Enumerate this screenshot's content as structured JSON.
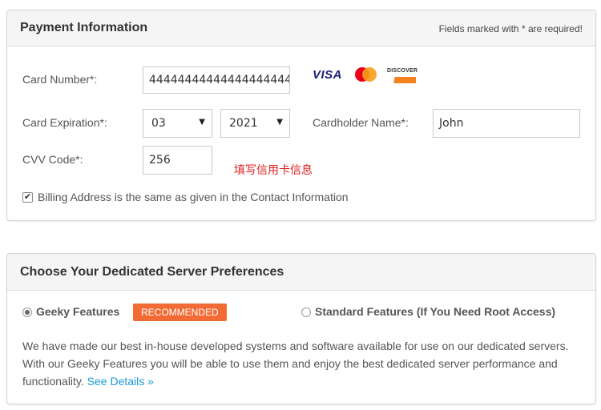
{
  "payment": {
    "title": "Payment Information",
    "required_note": "Fields marked with * are required!",
    "card_number": {
      "label": "Card Number*:",
      "value": "4444444444444444444444"
    },
    "card_logos": [
      "visa-logo",
      "mastercard-logo",
      "discover-logo"
    ],
    "visa_text": "VISA",
    "discover_text": "DISCOVER",
    "expiration": {
      "label": "Card Expiration*:",
      "month": "03",
      "year": "2021"
    },
    "cardholder": {
      "label": "Cardholder Name*:",
      "value": "John"
    },
    "cvv": {
      "label": "CVV Code*:",
      "value": "256"
    },
    "annotation": "填写信用卡信息",
    "billing_same": {
      "checked": true,
      "label": "Billing Address is the same as given in the Contact Information"
    }
  },
  "server": {
    "title": "Choose Your Dedicated Server Preferences",
    "geeky": {
      "label": "Geeky Features",
      "selected": true,
      "badge": "RECOMMENDED"
    },
    "standard": {
      "label": "Standard Features (If You Need Root Access)",
      "selected": false
    },
    "description": "We have made our best in-house developed systems and software available for use on our dedicated servers. With our Geeky Features you will be able to use them and enjoy the best dedicated server performance and functionality.",
    "details_link": "See Details »"
  },
  "colors": {
    "badge": "#f26b34",
    "link": "#1a9ad6",
    "annotation": "#e02020"
  }
}
